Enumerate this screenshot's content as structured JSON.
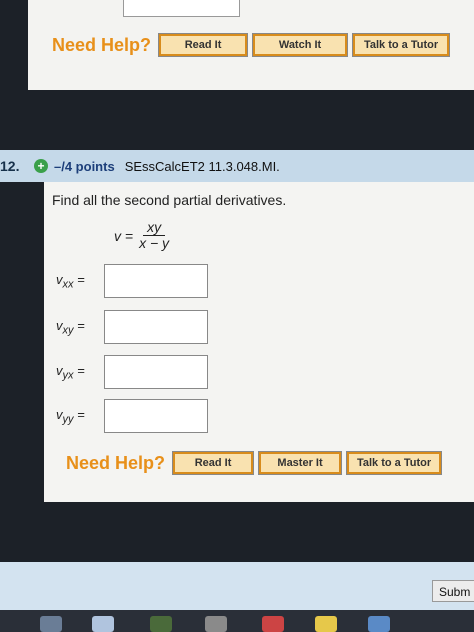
{
  "previous_question": {
    "need_help_label": "Need Help?",
    "buttons": [
      "Read It",
      "Watch It",
      "Talk to a Tutor"
    ]
  },
  "question": {
    "number": "12.",
    "points": "–/4 points",
    "id": "SEssCalcET2 11.3.048.MI.",
    "prompt": "Find all the second partial derivatives.",
    "equation": {
      "lhs": "v =",
      "numerator": "xy",
      "denominator": "x − y"
    },
    "answers": [
      {
        "label": "v",
        "sub": "xx",
        "suffix": " =",
        "value": ""
      },
      {
        "label": "v",
        "sub": "xy",
        "suffix": " =",
        "value": ""
      },
      {
        "label": "v",
        "sub": "yx",
        "suffix": " =",
        "value": ""
      },
      {
        "label": "v",
        "sub": "yy",
        "suffix": " =",
        "value": ""
      }
    ],
    "need_help_label": "Need Help?",
    "buttons": [
      "Read It",
      "Master It",
      "Talk to a Tutor"
    ]
  },
  "footer": {
    "submit_label": "Subm"
  },
  "colors": {
    "accent_orange": "#e8901a",
    "header_blue": "#c5d9e9",
    "points_blue": "#1d3f7a",
    "plus_green": "#3aa04a"
  }
}
